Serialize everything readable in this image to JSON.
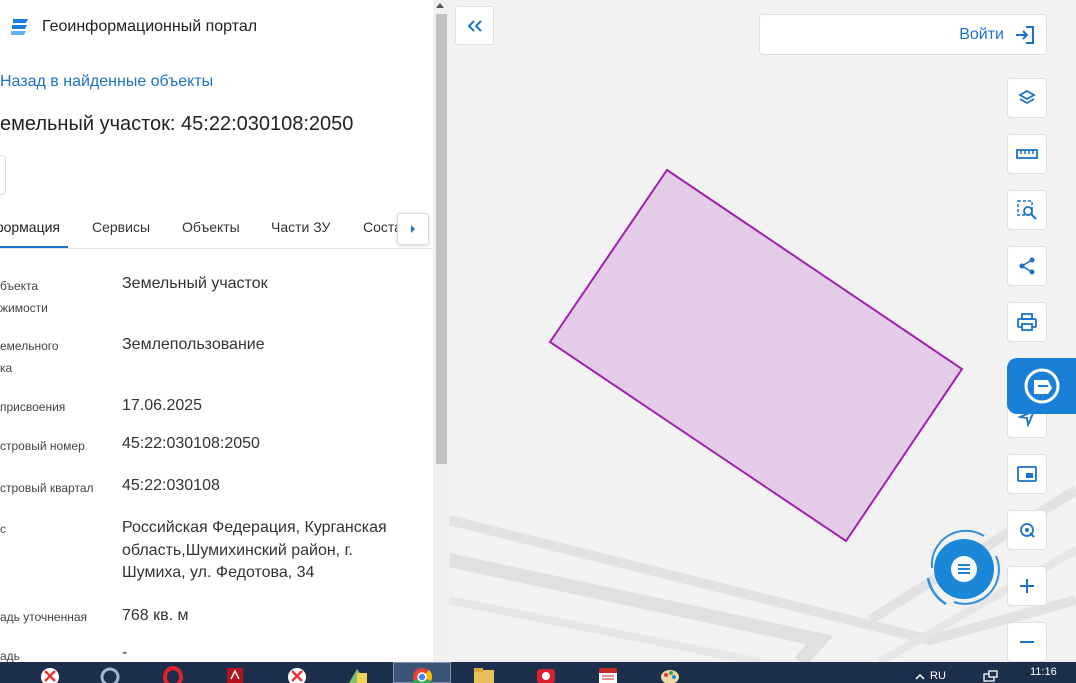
{
  "header": {
    "portal_title": "Геоинформационный портал"
  },
  "nav": {
    "back_label": "Назад в найденные объекты"
  },
  "object": {
    "title": "емельный участок: 45:22:030108:2050"
  },
  "tabs": [
    {
      "label": "формация"
    },
    {
      "label": "Сервисы"
    },
    {
      "label": "Объекты"
    },
    {
      "label": "Части ЗУ"
    },
    {
      "label": "Соста"
    }
  ],
  "info_rows": [
    {
      "label_line1": "бъекта",
      "label_line2": "жимости",
      "value": "Земельный участок"
    },
    {
      "label_line1": "емельного",
      "label_line2": "ка",
      "value": "Землепользование"
    },
    {
      "label_line1": "присвоения",
      "value": "17.06.2025"
    },
    {
      "label_line1": "стровый номер",
      "value": "45:22:030108:2050"
    },
    {
      "label_line1": "стровый квартал",
      "value": "45:22:030108"
    },
    {
      "label_line1": "с",
      "value_line1": "Российская Федерация, Курганская",
      "value_line2": "область,Шумихинский район, г.",
      "value_line3": "Шумиха, ул. Федотова, 34"
    },
    {
      "label_line1": "адь уточненная",
      "value": "768 кв. м"
    },
    {
      "label_line1": "адь",
      "value": "-"
    }
  ],
  "map": {
    "login_label": "Войти",
    "parcel_fill": "#e4cbe7",
    "parcel_stroke": "#a021b0",
    "accent": "#1a73c8"
  },
  "tools": [
    "layers-icon",
    "ruler-icon",
    "area-search-icon",
    "share-icon",
    "print-icon",
    "location-icon",
    "minimap-icon",
    "geolocate-icon",
    "zoom-in-icon",
    "zoom-out-icon"
  ],
  "taskbar": {
    "language": "RU",
    "time": "11:16"
  }
}
